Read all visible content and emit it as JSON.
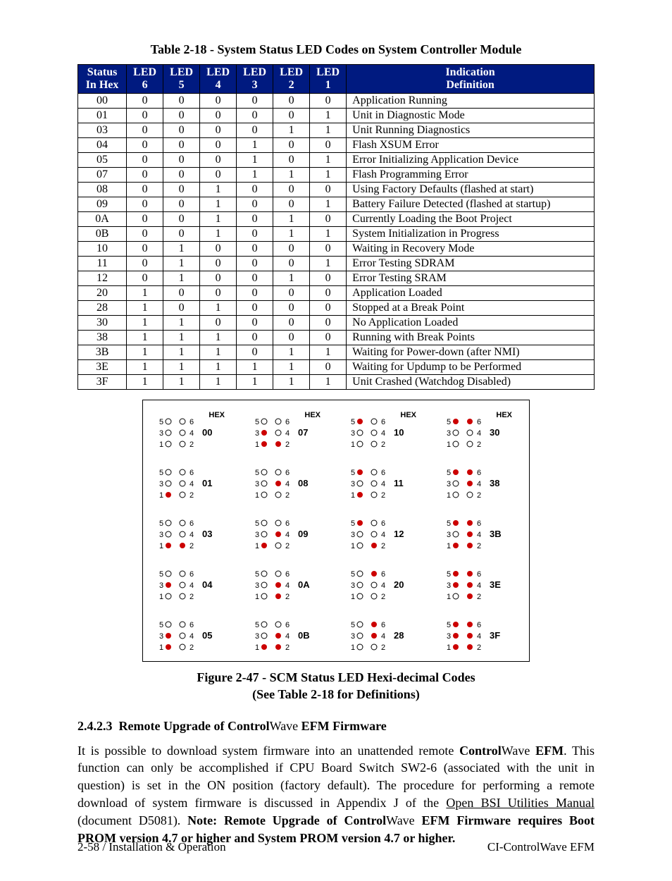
{
  "table_title": "Table 2-18 - System Status LED Codes on System Controller Module",
  "headers": {
    "status_top": "Status",
    "status_bot": "In Hex",
    "l6_top": "LED",
    "l6_bot": "6",
    "l5_top": "LED",
    "l5_bot": "5",
    "l4_top": "LED",
    "l4_bot": "4",
    "l3_top": "LED",
    "l3_bot": "3",
    "l2_top": "LED",
    "l2_bot": "2",
    "l1_top": "LED",
    "l1_bot": "1",
    "ind_top": "Indication",
    "ind_bot": "Definition"
  },
  "rows": [
    {
      "hex": "00",
      "l6": "0",
      "l5": "0",
      "l4": "0",
      "l3": "0",
      "l2": "0",
      "l1": "0",
      "def": "Application Running"
    },
    {
      "hex": "01",
      "l6": "0",
      "l5": "0",
      "l4": "0",
      "l3": "0",
      "l2": "0",
      "l1": "1",
      "def": "Unit in Diagnostic Mode"
    },
    {
      "hex": "03",
      "l6": "0",
      "l5": "0",
      "l4": "0",
      "l3": "0",
      "l2": "1",
      "l1": "1",
      "def": "Unit Running Diagnostics"
    },
    {
      "hex": "04",
      "l6": "0",
      "l5": "0",
      "l4": "0",
      "l3": "1",
      "l2": "0",
      "l1": "0",
      "def": "Flash XSUM Error"
    },
    {
      "hex": "05",
      "l6": "0",
      "l5": "0",
      "l4": "0",
      "l3": "1",
      "l2": "0",
      "l1": "1",
      "def": "Error Initializing Application Device"
    },
    {
      "hex": "07",
      "l6": "0",
      "l5": "0",
      "l4": "0",
      "l3": "1",
      "l2": "1",
      "l1": "1",
      "def": "Flash Programming Error"
    },
    {
      "hex": "08",
      "l6": "0",
      "l5": "0",
      "l4": "1",
      "l3": "0",
      "l2": "0",
      "l1": "0",
      "def": "Using Factory Defaults (flashed at start)"
    },
    {
      "hex": "09",
      "l6": "0",
      "l5": "0",
      "l4": "1",
      "l3": "0",
      "l2": "0",
      "l1": "1",
      "def": "Battery Failure Detected (flashed at startup)"
    },
    {
      "hex": "0A",
      "l6": "0",
      "l5": "0",
      "l4": "1",
      "l3": "0",
      "l2": "1",
      "l1": "0",
      "def": "Currently Loading the Boot Project"
    },
    {
      "hex": "0B",
      "l6": "0",
      "l5": "0",
      "l4": "1",
      "l3": "0",
      "l2": "1",
      "l1": "1",
      "def": "System Initialization in Progress"
    },
    {
      "hex": "10",
      "l6": "0",
      "l5": "1",
      "l4": "0",
      "l3": "0",
      "l2": "0",
      "l1": "0",
      "def": "Waiting in Recovery Mode"
    },
    {
      "hex": "11",
      "l6": "0",
      "l5": "1",
      "l4": "0",
      "l3": "0",
      "l2": "0",
      "l1": "1",
      "def": "Error Testing SDRAM"
    },
    {
      "hex": "12",
      "l6": "0",
      "l5": "1",
      "l4": "0",
      "l3": "0",
      "l2": "1",
      "l1": "0",
      "def": "Error Testing SRAM"
    },
    {
      "hex": "20",
      "l6": "1",
      "l5": "0",
      "l4": "0",
      "l3": "0",
      "l2": "0",
      "l1": "0",
      "def": "Application Loaded"
    },
    {
      "hex": "28",
      "l6": "1",
      "l5": "0",
      "l4": "1",
      "l3": "0",
      "l2": "0",
      "l1": "0",
      "def": "Stopped at a Break Point"
    },
    {
      "hex": "30",
      "l6": "1",
      "l5": "1",
      "l4": "0",
      "l3": "0",
      "l2": "0",
      "l1": "0",
      "def": "No Application Loaded"
    },
    {
      "hex": "38",
      "l6": "1",
      "l5": "1",
      "l4": "1",
      "l3": "0",
      "l2": "0",
      "l1": "0",
      "def": "Running with Break Points"
    },
    {
      "hex": "3B",
      "l6": "1",
      "l5": "1",
      "l4": "1",
      "l3": "0",
      "l2": "1",
      "l1": "1",
      "def": "Waiting for Power-down (after NMI)"
    },
    {
      "hex": "3E",
      "l6": "1",
      "l5": "1",
      "l4": "1",
      "l3": "1",
      "l2": "1",
      "l1": "0",
      "def": "Waiting for Updump to be Performed"
    },
    {
      "hex": "3F",
      "l6": "1",
      "l5": "1",
      "l4": "1",
      "l3": "1",
      "l2": "1",
      "l1": "1",
      "def": "Unit Crashed (Watchdog Disabled)"
    }
  ],
  "figure": {
    "hex_label": "HEX",
    "caption_l1": "Figure 2-47 - SCM Status LED Hexi-decimal Codes",
    "caption_l2": "(See Table 2-18 for Definitions)",
    "codes": [
      "00",
      "01",
      "03",
      "04",
      "05",
      "07",
      "08",
      "09",
      "0A",
      "0B",
      "10",
      "11",
      "12",
      "20",
      "28",
      "30",
      "38",
      "3B",
      "3E",
      "3F"
    ]
  },
  "section": {
    "num": "2.4.2.3",
    "title_a": "Remote Upgrade of Control",
    "title_b": "Wave ",
    "title_c": "EFM Firmware",
    "para1_a": "It is possible to download system firmware into an unattended remote ",
    "para1_b": "Control",
    "para1_c": "Wave ",
    "para1_d": "EFM",
    "para1_e": ". This function can only be accomplished if CPU Board Switch SW2-6 (associated with the unit in question) is set in the ON position (factory default). The procedure for performing a remote download of system firmware is discussed in Appendix J of the ",
    "para1_f": "Open BSI Utilities Manual",
    "para1_g": " (document D5081). ",
    "note_a": "Note: Remote Upgrade of Control",
    "note_b": "Wave ",
    "note_c": "EFM Firmware requires Boot PROM version 4.7 or higher and System PROM version 4.7 or higher."
  },
  "footer": {
    "left": "2-58 / Installation & Operation",
    "right": "CI-ControlWave EFM"
  }
}
